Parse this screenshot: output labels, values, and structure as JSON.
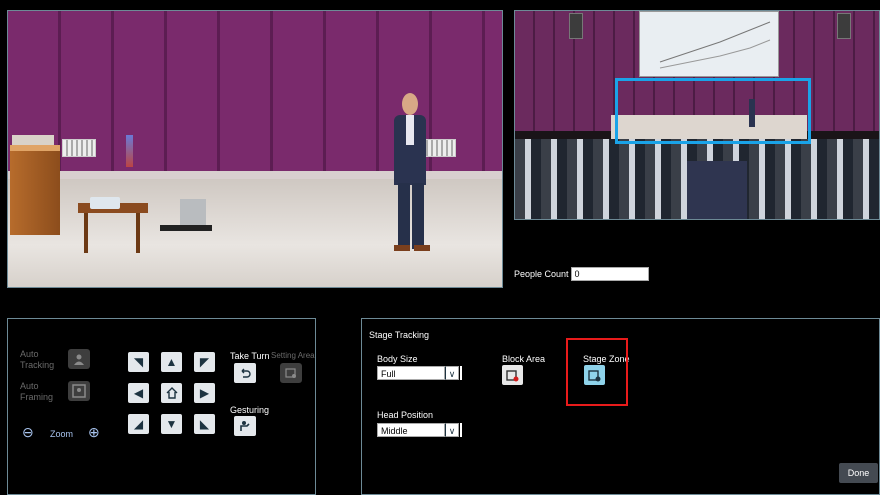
{
  "people_count": {
    "label": "People Count",
    "value": "0"
  },
  "ptz": {
    "auto_tracking_label": "Auto Tracking",
    "auto_framing_label": "Auto Framing",
    "zoom_label": "Zoom",
    "take_turn_label": "Take Turn",
    "setting_area_label": "Setting Area",
    "gesturing_label": "Gesturing"
  },
  "stage_tracking": {
    "title": "Stage Tracking",
    "body_size_label": "Body Size",
    "body_size_value": "Full",
    "block_area_label": "Block Area",
    "stage_zone_label": "Stage Zone",
    "head_position_label": "Head Position",
    "head_position_value": "Middle"
  },
  "done_label": "Done",
  "colors": {
    "stage_zone_box": "#1aa3e8",
    "highlight": "#e81b1b",
    "panel_border": "#6d8a96"
  }
}
